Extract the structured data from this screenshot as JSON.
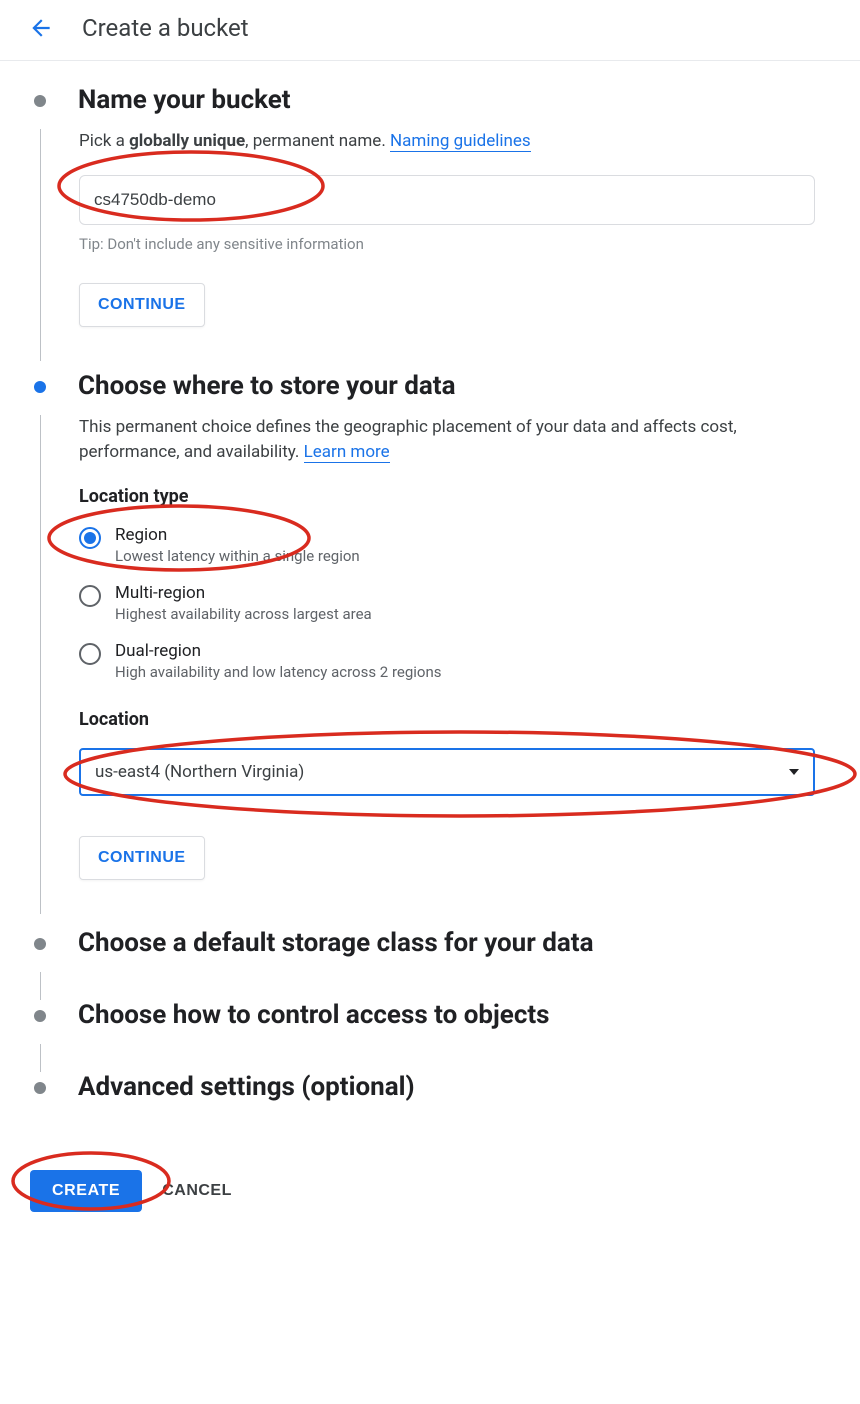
{
  "header": {
    "title": "Create a bucket"
  },
  "steps": {
    "name": {
      "title": "Name your bucket",
      "desc_prefix": "Pick a ",
      "desc_bold": "globally unique",
      "desc_suffix": ", permanent name. ",
      "link": "Naming guidelines",
      "input_value": "cs4750db-demo",
      "tip": "Tip: Don't include any sensitive information",
      "continue": "CONTINUE"
    },
    "location": {
      "title": "Choose where to store your data",
      "desc": "This permanent choice defines the geographic placement of your data and affects cost, performance, and availability. ",
      "link": "Learn more",
      "location_type_label": "Location type",
      "options": [
        {
          "label": "Region",
          "desc": "Lowest latency within a single region",
          "selected": true
        },
        {
          "label": "Multi-region",
          "desc": "Highest availability across largest area",
          "selected": false
        },
        {
          "label": "Dual-region",
          "desc": "High availability and low latency across 2 regions",
          "selected": false
        }
      ],
      "location_label": "Location",
      "location_value": "us-east4 (Northern Virginia)",
      "continue": "CONTINUE"
    },
    "storage_class": {
      "title": "Choose a default storage class for your data"
    },
    "access": {
      "title": "Choose how to control access to objects"
    },
    "advanced": {
      "title": "Advanced settings (optional)"
    }
  },
  "footer": {
    "create": "CREATE",
    "cancel": "CANCEL"
  }
}
